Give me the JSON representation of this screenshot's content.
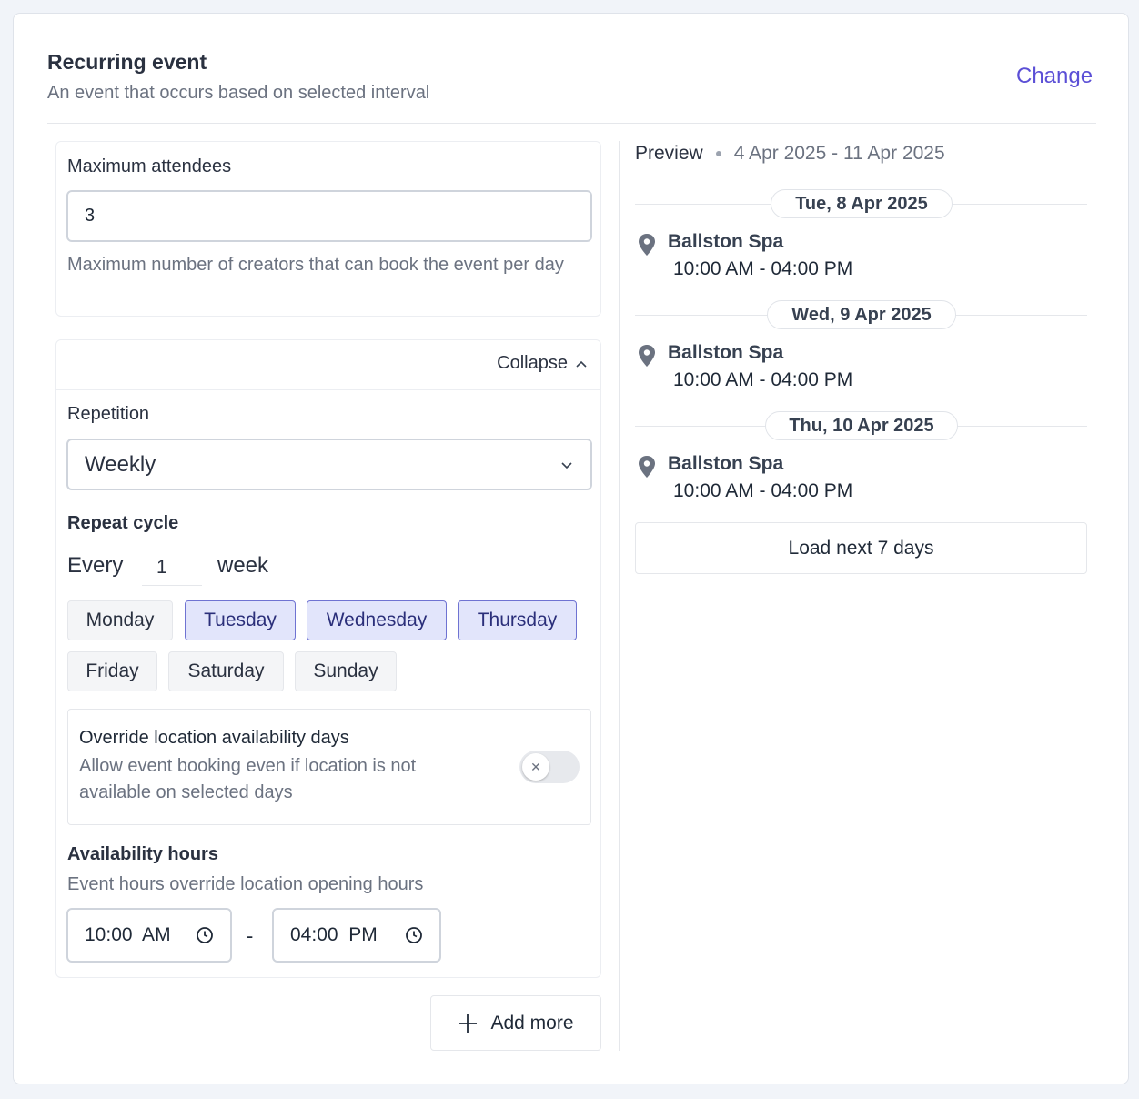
{
  "header": {
    "title": "Recurring event",
    "subtitle": "An event that occurs based on selected interval",
    "change_label": "Change"
  },
  "attendees": {
    "label": "Maximum attendees",
    "value": "3",
    "help": "Maximum number of creators that can book the event per day"
  },
  "collapse_label": "Collapse",
  "repetition": {
    "label": "Repetition",
    "selected": "Weekly"
  },
  "repeat_cycle": {
    "label": "Repeat cycle",
    "every_label": "Every",
    "every_value": "1",
    "unit": "week"
  },
  "days": [
    {
      "label": "Monday",
      "selected": false
    },
    {
      "label": "Tuesday",
      "selected": true
    },
    {
      "label": "Wednesday",
      "selected": true
    },
    {
      "label": "Thursday",
      "selected": true
    },
    {
      "label": "Friday",
      "selected": false
    },
    {
      "label": "Saturday",
      "selected": false
    },
    {
      "label": "Sunday",
      "selected": false
    }
  ],
  "override": {
    "title": "Override location availability days",
    "description": "Allow event booking even if location is not available on selected days",
    "enabled": false
  },
  "availability": {
    "label": "Availability hours",
    "help": "Event hours override location opening hours",
    "start": "10:00  AM",
    "separator": "-",
    "end": "04:00  PM"
  },
  "add_more_label": "Add more",
  "preview": {
    "label": "Preview",
    "range": "4 Apr 2025 - 11 Apr 2025",
    "days": [
      {
        "date": "Tue, 8 Apr 2025",
        "location": "Ballston Spa",
        "time": "10:00 AM - 04:00 PM"
      },
      {
        "date": "Wed, 9 Apr 2025",
        "location": "Ballston Spa",
        "time": "10:00 AM - 04:00 PM"
      },
      {
        "date": "Thu, 10 Apr 2025",
        "location": "Ballston Spa",
        "time": "10:00 AM - 04:00 PM"
      }
    ],
    "load_more_label": "Load next 7 days"
  }
}
